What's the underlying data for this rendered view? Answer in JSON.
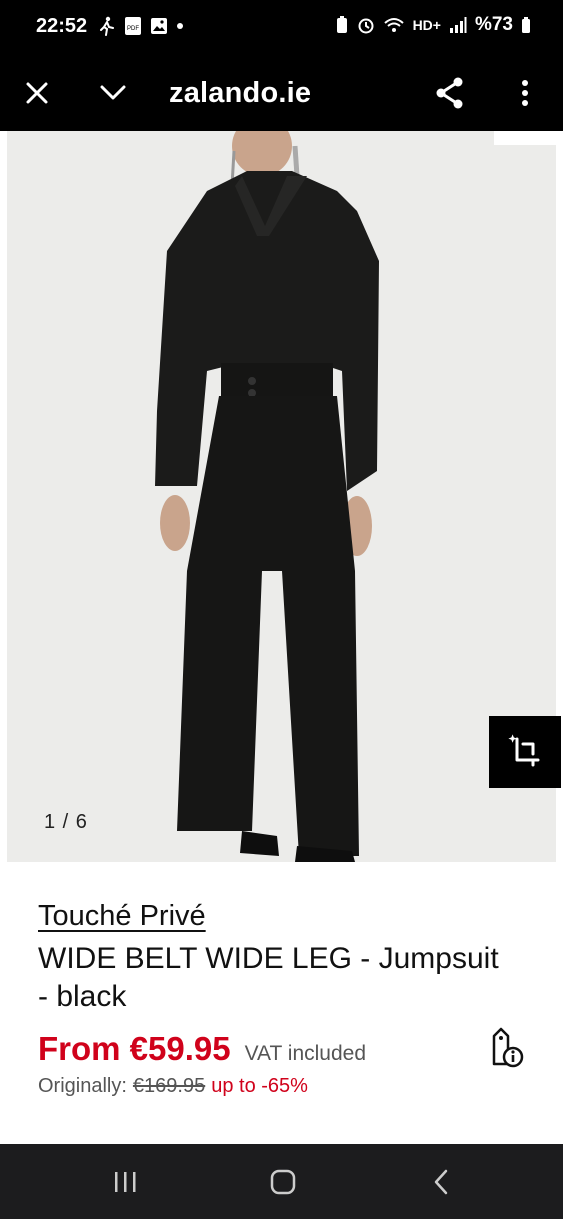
{
  "status_bar": {
    "time": "22:52",
    "battery": "%73",
    "network": "HD+"
  },
  "app_bar": {
    "title": "zalando.ie",
    "icons": [
      "close-icon",
      "chevron-down-icon",
      "share-icon",
      "more-vertical-icon"
    ]
  },
  "gallery": {
    "counter": "1 / 6",
    "image_description_icon": "product-photo"
  },
  "product": {
    "brand": "Touché Privé",
    "name": "WIDE BELT WIDE LEG - Jumpsuit - black",
    "price": "From €59.95",
    "vat": "VAT included",
    "original_label": "Originally:",
    "original_price": "€169.95",
    "discount": "up to -65%"
  },
  "colors": {
    "sale_red": "#d0021b",
    "bar_black": "#000000",
    "nav_dark": "#1c1c1e"
  }
}
